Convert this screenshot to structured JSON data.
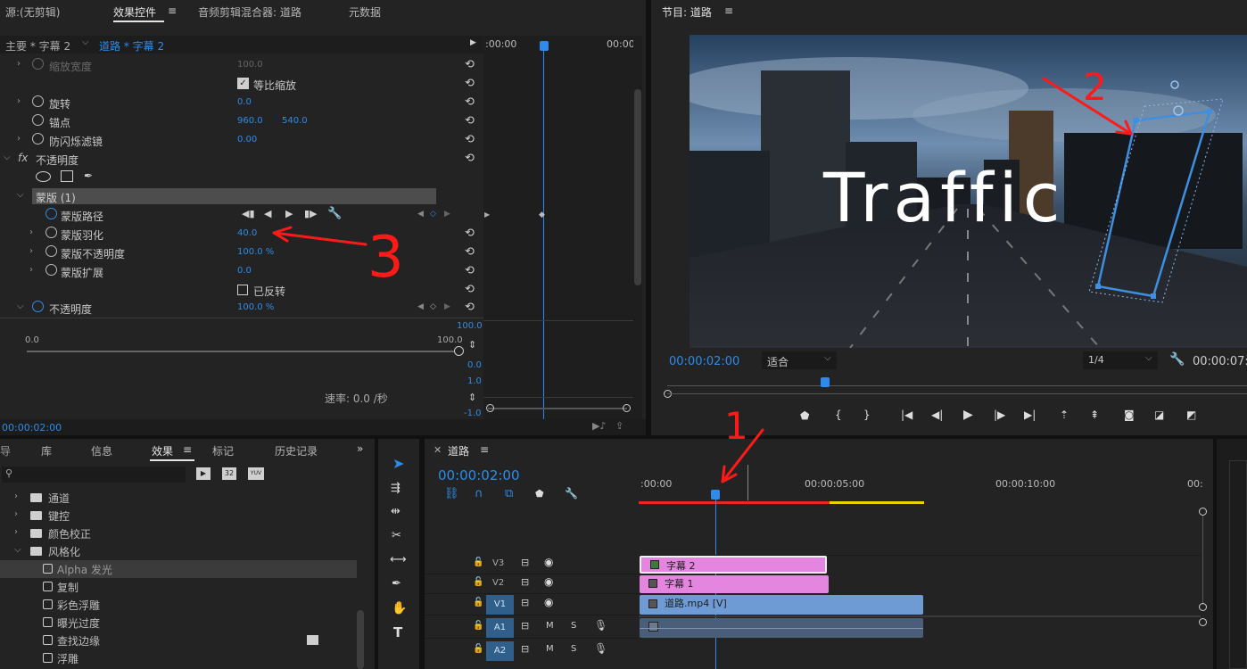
{
  "source_panel": {
    "tabs": [
      "源:(无剪辑)",
      "效果控件",
      "音频剪辑混合器: 道路",
      "元数据"
    ],
    "active_tab": "效果控件",
    "master_label": "主要 * 字幕 2",
    "clip_label": "道路 * 字幕 2",
    "time_start": ":00:00",
    "time_end": "00:00",
    "rows": {
      "scale_width": {
        "label": "缩放宽度",
        "value": "100.0"
      },
      "uniform_scale": "等比缩放",
      "rotation": {
        "label": "旋转",
        "value": "0.0"
      },
      "anchor": {
        "label": "锚点",
        "x": "960.0",
        "y": "540.0"
      },
      "flicker": {
        "label": "防闪烁滤镜",
        "value": "0.00"
      },
      "opacity_group": "不透明度",
      "fx_symbol": "fx",
      "mask_header": "蒙版 (1)",
      "mask_path": "蒙版路径",
      "mask_feather": {
        "label": "蒙版羽化",
        "value": "40.0"
      },
      "mask_opacity": {
        "label": "蒙版不透明度",
        "value": "100.0 %"
      },
      "mask_expansion": {
        "label": "蒙版扩展",
        "value": "0.0"
      },
      "inverted": "已反转",
      "opacity": {
        "label": "不透明度",
        "value": "100.0 %"
      }
    },
    "slider_min": "0.0",
    "slider_max": "100.0",
    "graph_top": "100.0",
    "graph_mid": "0.0",
    "graph_rate_top": "1.0",
    "graph_rate_bottom": "-1.0",
    "rate_label": "速率: 0.0 /秒",
    "footer_time": "00:00:02:00"
  },
  "program_panel": {
    "title": "节目: 道路",
    "overlay_text": "Traffic",
    "timecode": "00:00:02:00",
    "fit": "适合",
    "resolution": "1/4",
    "duration": "00:00:07:"
  },
  "annotations": [
    "1",
    "2",
    "3"
  ],
  "effects_panel": {
    "tabs": [
      "库",
      "信息",
      "效果",
      "标记",
      "历史记录"
    ],
    "active_tab": "效果",
    "search_placeholder": "",
    "badges": [
      "32",
      "YUV"
    ],
    "tree": [
      {
        "label": "通道",
        "type": "folder",
        "expanded": false
      },
      {
        "label": "键控",
        "type": "folder",
        "expanded": false
      },
      {
        "label": "颜色校正",
        "type": "folder",
        "expanded": false
      },
      {
        "label": "风格化",
        "type": "folder",
        "expanded": true
      },
      {
        "label": "Alpha 发光",
        "type": "effect",
        "selected": true
      },
      {
        "label": "复制",
        "type": "effect"
      },
      {
        "label": "彩色浮雕",
        "type": "effect"
      },
      {
        "label": "曝光过度",
        "type": "effect"
      },
      {
        "label": "查找边缘",
        "type": "effect"
      },
      {
        "label": "浮雕",
        "type": "effect"
      }
    ]
  },
  "timeline": {
    "title": "道路",
    "timecode": "00:00:02:00",
    "ruler": [
      ":00:00",
      "00:00:05:00",
      "00:00:10:00",
      "00:"
    ],
    "tracks": [
      {
        "name": "V3",
        "clip": "字幕 2"
      },
      {
        "name": "V2",
        "clip": "字幕 1"
      },
      {
        "name": "V1",
        "clip": "道路.mp4 [V]"
      },
      {
        "name": "A1",
        "clip": ""
      },
      {
        "name": "A2",
        "clip": ""
      }
    ],
    "track_letters": [
      "M",
      "S"
    ]
  },
  "colors": {
    "accent": "#2d8ceb",
    "caption_clip": "#e486df",
    "video_clip": "#6e9bd3",
    "audio_clip": "#4a5e7a",
    "annotation_red": "#ff1a1a"
  }
}
